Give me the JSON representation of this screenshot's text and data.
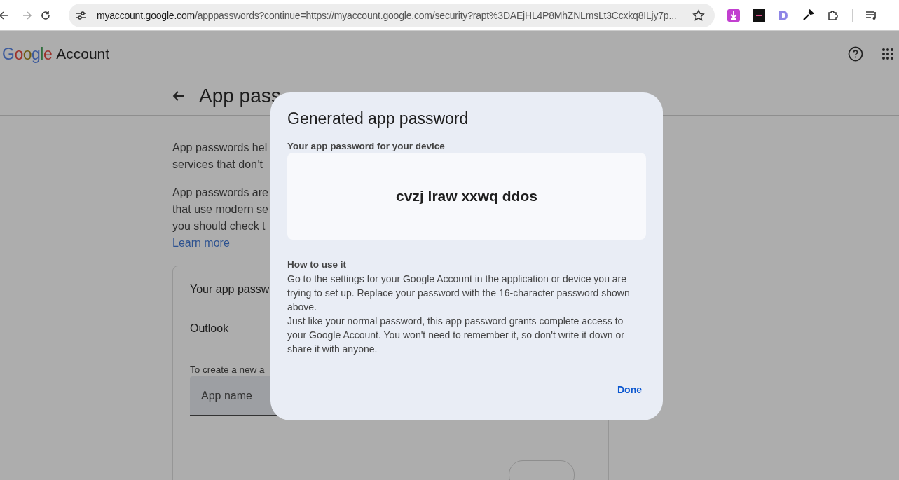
{
  "browser": {
    "url_host": "myaccount.google.com",
    "url_rest": "/apppasswords?continue=https://myaccount.google.com/security?rapt%3DAEjHL4P8MhZNLmsLt3Ccxkq8ILjy7p..."
  },
  "header": {
    "logo": "Google",
    "product": "Account"
  },
  "page": {
    "title": "App pass",
    "intro": [
      "App passwords hel",
      "services that don’t"
    ],
    "paragraph": [
      "App passwords are",
      "that use modern se",
      "you should check t"
    ],
    "link": "Learn more",
    "card": {
      "heading": "Your app passw",
      "app": "Outlook",
      "hint": "To create a new a",
      "field": {
        "placeholder": "App name"
      }
    }
  },
  "dialog": {
    "title": "Generated app password",
    "label": "Your app password for your device",
    "password": "cvzj lraw xxwq ddos",
    "how_heading": "How to use it",
    "instructions": [
      "Go to the settings for your Google Account in the application or device you are trying to set up. Replace your password with the 16-character password shown above.",
      "Just like your normal password, this app password grants complete access to your Google Account. You won't need to remember it, so don't write it down or share it with anyone."
    ],
    "button": "Done"
  }
}
